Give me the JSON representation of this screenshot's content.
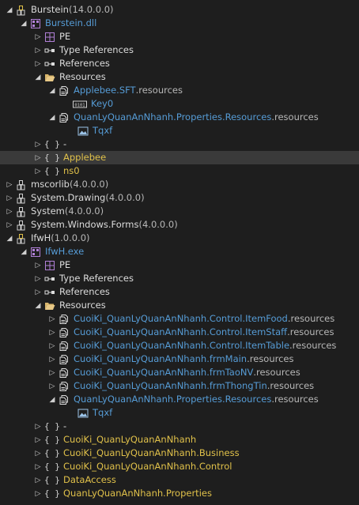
{
  "colors": {
    "background": "#1e1e1e",
    "selection": "#3a3a3a",
    "type_blue": "#569cd6",
    "namespace_yellow": "#e0c14a",
    "text": "#dcdcdc",
    "suffix_gray": "#b8b8b8"
  },
  "tree": {
    "burstein": {
      "name": "Burstein",
      "version": " (14.0.0.0)"
    },
    "burstein_dll": {
      "name": "Burstein.dll"
    },
    "pe_1": "PE",
    "type_refs_1": "Type References",
    "refs_1": "References",
    "resources_1": "Resources",
    "applebee_sft": {
      "name": "Applebee.SFT",
      "suffix": ".resources"
    },
    "key0": "Key0",
    "ql_props_1": {
      "name": "QuanLyQuanAnNhanh.Properties.Resources",
      "suffix": ".resources"
    },
    "tqxf_1": "Tqxf",
    "ns_dash_1": "-",
    "ns_applebee": "Applebee",
    "ns_ns0": "ns0",
    "mscorlib": {
      "name": "mscorlib",
      "version": " (4.0.0.0)"
    },
    "system_drawing": {
      "name": "System.Drawing",
      "version": " (4.0.0.0)"
    },
    "system": {
      "name": "System",
      "version": " (4.0.0.0)"
    },
    "system_forms": {
      "name": "System.Windows.Forms",
      "version": " (4.0.0.0)"
    },
    "ifwh": {
      "name": "IfwH",
      "version": " (1.0.0.0)"
    },
    "ifwh_exe": {
      "name": "IfwH.exe"
    },
    "pe_2": "PE",
    "type_refs_2": "Type References",
    "refs_2": "References",
    "resources_2": "Resources",
    "res_itemfood": {
      "name": "CuoiKi_QuanLyQuanAnNhanh.Control.ItemFood",
      "suffix": ".resources"
    },
    "res_itemstaff": {
      "name": "CuoiKi_QuanLyQuanAnNhanh.Control.ItemStaff",
      "suffix": ".resources"
    },
    "res_itemtable": {
      "name": "CuoiKi_QuanLyQuanAnNhanh.Control.ItemTable",
      "suffix": ".resources"
    },
    "res_frmmain": {
      "name": "CuoiKi_QuanLyQuanAnNhanh.frmMain",
      "suffix": ".resources"
    },
    "res_frmtaonv": {
      "name": "CuoiKi_QuanLyQuanAnNhanh.frmTaoNV",
      "suffix": ".resources"
    },
    "res_frmthongtin": {
      "name": "CuoiKi_QuanLyQuanAnNhanh.frmThongTin",
      "suffix": ".resources"
    },
    "ql_props_2": {
      "name": "QuanLyQuanAnNhanh.Properties.Resources",
      "suffix": ".resources"
    },
    "tqxf_2": "Tqxf",
    "ns_dash_2": "-",
    "ns_cuoiki": "CuoiKi_QuanLyQuanAnNhanh",
    "ns_business": "CuoiKi_QuanLyQuanAnNhanh.Business",
    "ns_control": "CuoiKi_QuanLyQuanAnNhanh.Control",
    "ns_dataaccess": "DataAccess",
    "ns_properties": "QuanLyQuanAnNhanh.Properties"
  }
}
